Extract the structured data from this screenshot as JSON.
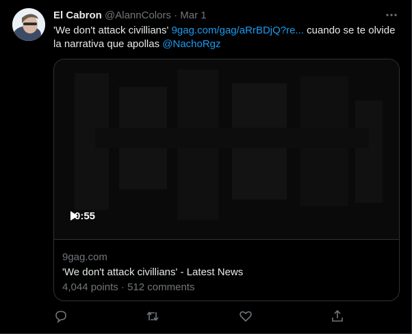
{
  "tweet": {
    "display_name": "El Cabron",
    "handle": "@AlannColors",
    "separator": "·",
    "date": "Mar 1",
    "text_before": "'We don't attack civillians' ",
    "link_text": "9gag.com/gag/aRrBDjQ?re...",
    "text_after": " cuando se te olvide la narrativa que apollas ",
    "mention": "@NachoRgz"
  },
  "card": {
    "duration": "0:55",
    "domain": "9gag.com",
    "title": "'We don't attack civillians' - Latest News",
    "points": "4,044 points",
    "dot": "·",
    "comments": "512 comments"
  },
  "icons": {
    "more": "more-dots-icon",
    "play": "play-icon",
    "reply": "reply-icon",
    "retweet": "retweet-icon",
    "like": "like-icon",
    "share": "share-icon"
  },
  "colors": {
    "background": "#000000",
    "link": "#1d9bf0",
    "muted": "#71767b",
    "text": "#e7e9ea",
    "border": "#2f3336"
  }
}
